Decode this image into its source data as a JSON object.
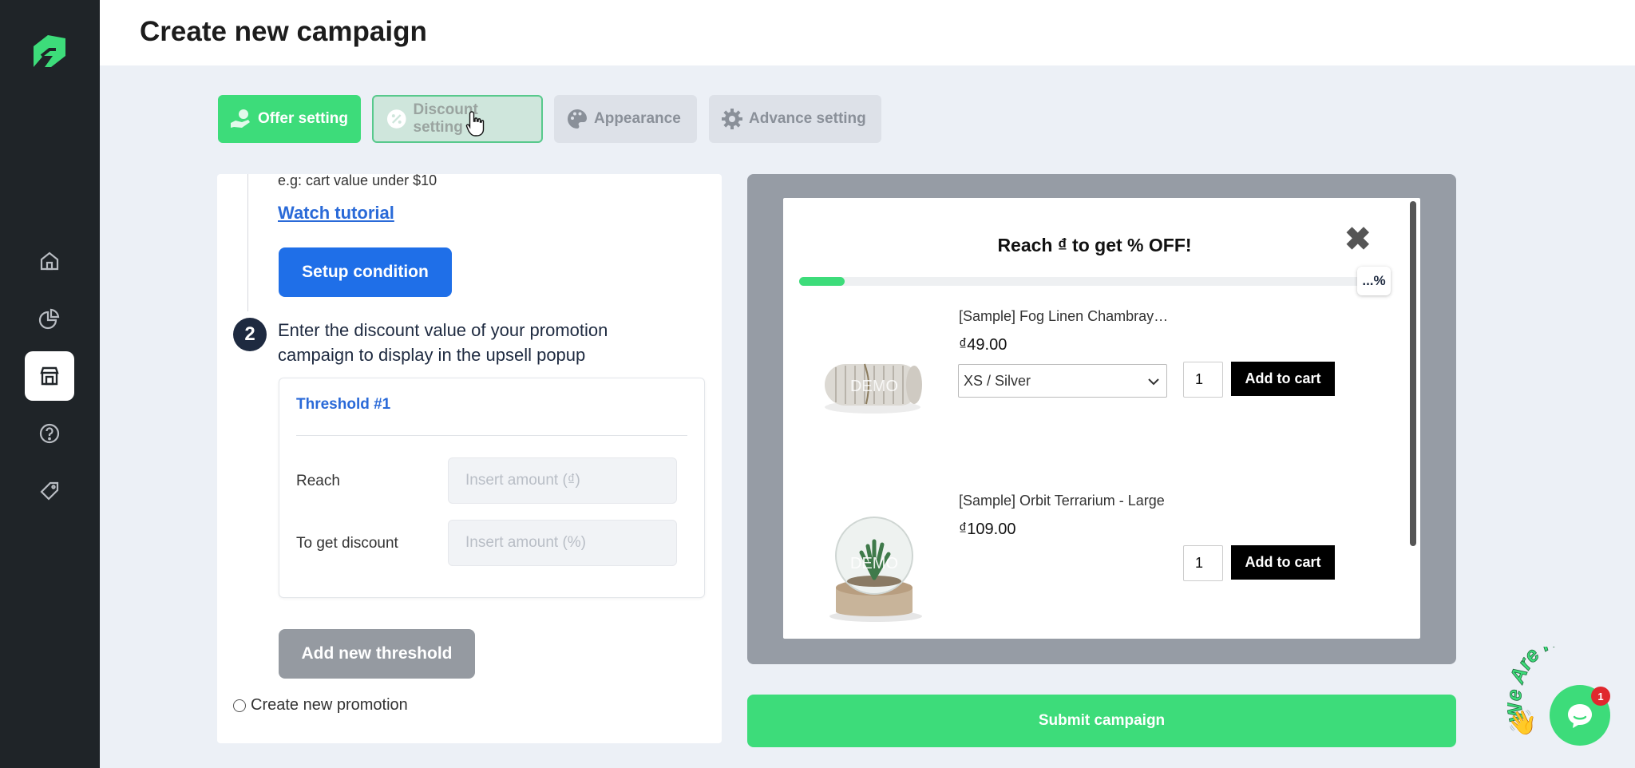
{
  "header": {
    "title": "Create new campaign"
  },
  "sidebar": {
    "items": [
      {
        "icon": "home-icon"
      },
      {
        "icon": "chart-pie-icon"
      },
      {
        "icon": "store-icon",
        "active": true
      },
      {
        "icon": "help-icon"
      },
      {
        "icon": "tag-icon"
      }
    ]
  },
  "tabs": [
    {
      "label": "Offer setting",
      "icon": "hand-coin-icon",
      "state": "completed"
    },
    {
      "label": "Discount setting",
      "icon": "percent-badge-icon",
      "state": "current"
    },
    {
      "label": "Appearance",
      "icon": "palette-icon",
      "state": "inactive"
    },
    {
      "label": "Advance setting",
      "icon": "gear-icon",
      "state": "inactive"
    }
  ],
  "form": {
    "hint": "e.g: cart value under $10",
    "watch_tutorial": "Watch tutorial",
    "setup_condition": "Setup condition",
    "step_number": "2",
    "step_text": "Enter the discount value of your promotion campaign to display in the upsell popup",
    "threshold": {
      "title": "Threshold #1",
      "reach_label": "Reach",
      "reach_placeholder": "Insert amount (₫)",
      "discount_label": "To get discount",
      "discount_placeholder": "Insert amount (%)"
    },
    "add_threshold": "Add new threshold",
    "create_promotion": "Create new promotion"
  },
  "preview": {
    "title": "Reach ₫ to get % OFF!",
    "close": "✖",
    "progress_fraction": 0.08,
    "progress_badge": "...%",
    "products": [
      {
        "name": "[Sample] Fog Linen Chambray…",
        "price": "₫49.00",
        "variant": "XS / Silver",
        "qty": "1",
        "add_label": "Add to cart",
        "watermark": "DEMO"
      },
      {
        "name": "[Sample] Orbit Terrarium - Large",
        "price": "₫109.00",
        "qty": "1",
        "add_label": "Add to cart",
        "watermark": "DEMO"
      }
    ]
  },
  "submit": "Submit campaign",
  "chat": {
    "badge": "1",
    "text": "We Are Here!"
  },
  "colors": {
    "accent": "#3ddc7a",
    "primary": "#1f6fe8",
    "sidebar": "#1f2428"
  }
}
